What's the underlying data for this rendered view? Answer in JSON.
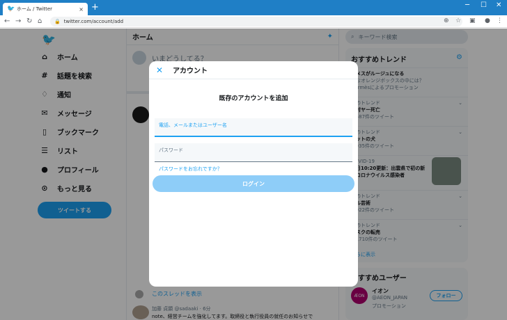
{
  "browser": {
    "tab_title": "ホーム / Twitter",
    "tab_close": "×",
    "new_tab": "+",
    "win_min": "─",
    "win_max": "☐",
    "win_close": "✕",
    "url": "twitter.com/account/add"
  },
  "sidebar": {
    "items": [
      {
        "label": "ホーム",
        "icon": "home-icon"
      },
      {
        "label": "話題を検索",
        "icon": "hashtag-icon"
      },
      {
        "label": "通知",
        "icon": "bell-icon"
      },
      {
        "label": "メッセージ",
        "icon": "mail-icon"
      },
      {
        "label": "ブックマーク",
        "icon": "bookmark-icon"
      },
      {
        "label": "リスト",
        "icon": "list-icon"
      },
      {
        "label": "プロフィール",
        "icon": "avatar"
      },
      {
        "label": "もっと見る",
        "icon": "more-icon"
      }
    ],
    "tweet_button": "ツイートする"
  },
  "timeline": {
    "header": "ホーム",
    "compose_placeholder": "いまどうしてる？",
    "thread_link": "このスレッドを表示",
    "tweet2_meta": "加藤 貞顕 @sadaaki · 6分",
    "tweet2_text": "note、経営チームを強化してます。取締役と執行役員の就任のお知らせで"
  },
  "right": {
    "search_placeholder": "キーワード検索",
    "trends_title": "おすすめトレンド",
    "trends": [
      {
        "context": "ルメスがルージュになる",
        "name": "きなオレンジボックスの中には？",
        "count": "Hermèsによるプロモーション"
      },
      {
        "context": "本のトレンド",
        "name": "志村ヤー死亡",
        "count": "3,587件のツイート"
      },
      {
        "context": "本のトレンド",
        "name": "ヒットの犬",
        "count": "4,935件のツイート"
      },
      {
        "context": "COVID-19",
        "name": "月日10:20更新：出雲県で初の新",
        "count": "型コロナウイルス感染者"
      },
      {
        "context": "本のトレンド",
        "name": "テル芸術",
        "count": "1,922件のツイート"
      },
      {
        "context": "本のトレンド",
        "name": "マスクの転売",
        "count": "13,710件のツイート"
      }
    ],
    "show_more": "さらに表示",
    "users_title": "おすすめユーザー",
    "user_name": "イオン",
    "user_handle": "@AEON_JAPAN",
    "user_promo": "プロモーション",
    "user_logo_text": "ÆON",
    "follow_label": "フォロー"
  },
  "modal": {
    "title": "アカウント",
    "heading": "既存のアカウントを追加",
    "username_label": "電話、メールまたはユーザー名",
    "password_label": "パスワード",
    "forgot_link": "パスワードをお忘れですか？",
    "login_button": "ログイン"
  },
  "colors": {
    "accent": "#1da1f2",
    "login_disabled": "#8ecdf8"
  }
}
